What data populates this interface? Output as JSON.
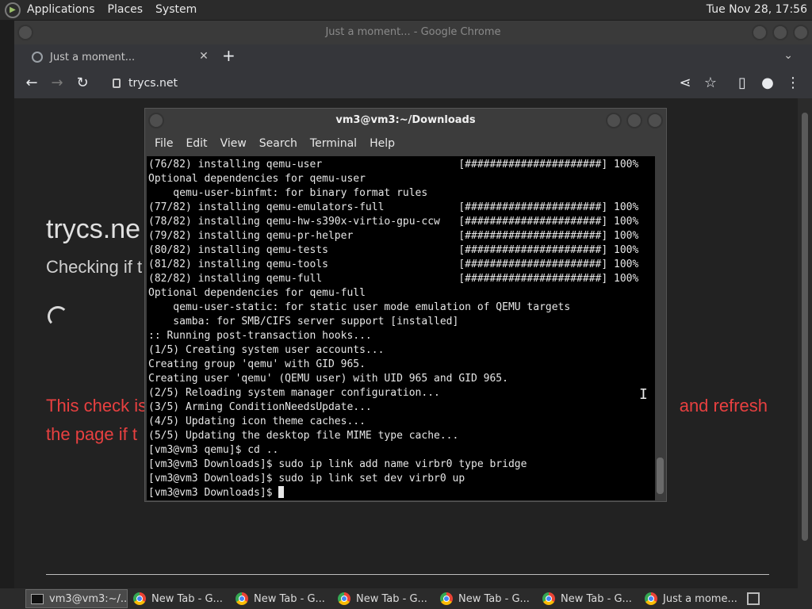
{
  "top_panel": {
    "menus": [
      "Applications",
      "Places",
      "System"
    ],
    "clock": "Tue Nov 28, 17:56"
  },
  "chrome": {
    "window_title": "Just a moment... - Google Chrome",
    "tab_title": "Just a moment...",
    "url": "trycs.net",
    "page": {
      "heading": "trycs.ne",
      "subheading": "Checking if t",
      "warning_left_1": "This check is",
      "warning_right_1": "and refresh",
      "warning_left_2": "the page if t"
    }
  },
  "terminal": {
    "title": "vm3@vm3:~/Downloads",
    "menu": [
      "File",
      "Edit",
      "View",
      "Search",
      "Terminal",
      "Help"
    ],
    "lines": [
      "(76/82) installing qemu-user                      [######################] 100%",
      "Optional dependencies for qemu-user",
      "    qemu-user-binfmt: for binary format rules",
      "(77/82) installing qemu-emulators-full            [######################] 100%",
      "(78/82) installing qemu-hw-s390x-virtio-gpu-ccw   [######################] 100%",
      "(79/82) installing qemu-pr-helper                 [######################] 100%",
      "(80/82) installing qemu-tests                     [######################] 100%",
      "(81/82) installing qemu-tools                     [######################] 100%",
      "(82/82) installing qemu-full                      [######################] 100%",
      "Optional dependencies for qemu-full",
      "    qemu-user-static: for static user mode emulation of QEMU targets",
      "    samba: for SMB/CIFS server support [installed]",
      ":: Running post-transaction hooks...",
      "(1/5) Creating system user accounts...",
      "Creating group 'qemu' with GID 965.",
      "Creating user 'qemu' (QEMU user) with UID 965 and GID 965.",
      "(2/5) Reloading system manager configuration...",
      "(3/5) Arming ConditionNeedsUpdate...",
      "(4/5) Updating icon theme caches...",
      "(5/5) Updating the desktop file MIME type cache...",
      "[vm3@vm3 qemu]$ cd ..",
      "[vm3@vm3 Downloads]$ sudo ip link add name virbr0 type bridge",
      "[vm3@vm3 Downloads]$ sudo ip link set dev virbr0 up"
    ],
    "prompt": "[vm3@vm3 Downloads]$ "
  },
  "taskbar": {
    "items": [
      {
        "label": "vm3@vm3:~/...",
        "icon": "terminal-icon",
        "active": true
      },
      {
        "label": "New Tab - G...",
        "icon": "chrome-icon"
      },
      {
        "label": "New Tab - G...",
        "icon": "chrome-icon"
      },
      {
        "label": "New Tab - G...",
        "icon": "chrome-icon"
      },
      {
        "label": "New Tab - G...",
        "icon": "chrome-icon"
      },
      {
        "label": "New Tab - G...",
        "icon": "chrome-icon"
      },
      {
        "label": "Just a mome...",
        "icon": "chrome-icon"
      }
    ]
  }
}
